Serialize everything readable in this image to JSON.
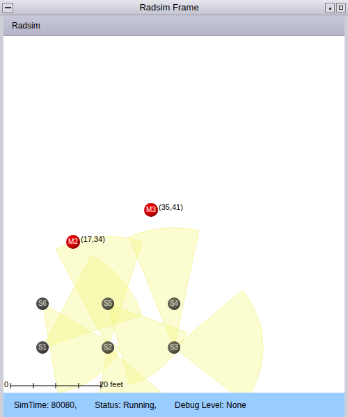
{
  "window": {
    "title": "Radsim Frame"
  },
  "menu": [
    {
      "label": "Radsim"
    }
  ],
  "canvas": {
    "nodes": [
      {
        "kind": "sensor",
        "label": "S6",
        "color": "#555555"
      },
      {
        "kind": "sensor",
        "label": "S5",
        "color": "#6b6b55"
      },
      {
        "kind": "sensor",
        "label": "S4",
        "color": "#6b6b55"
      },
      {
        "kind": "sensor",
        "label": "S1",
        "color": "#555555"
      },
      {
        "kind": "sensor",
        "label": "S2",
        "color": "#6b6b55"
      },
      {
        "kind": "sensor",
        "label": "S3",
        "color": "#6b6b55"
      },
      {
        "kind": "mobile",
        "label": "M2",
        "coords": "(17,34)",
        "color": "#e60000"
      },
      {
        "kind": "mobile",
        "label": "M3",
        "coords": "(35,41)",
        "color": "#e60000"
      }
    ],
    "scale": {
      "start": "0",
      "end": "20 feet"
    }
  },
  "status_bar": {
    "items": [
      "SimTime: 80080,",
      "Status: Running,",
      "Debug Level: None"
    ]
  }
}
